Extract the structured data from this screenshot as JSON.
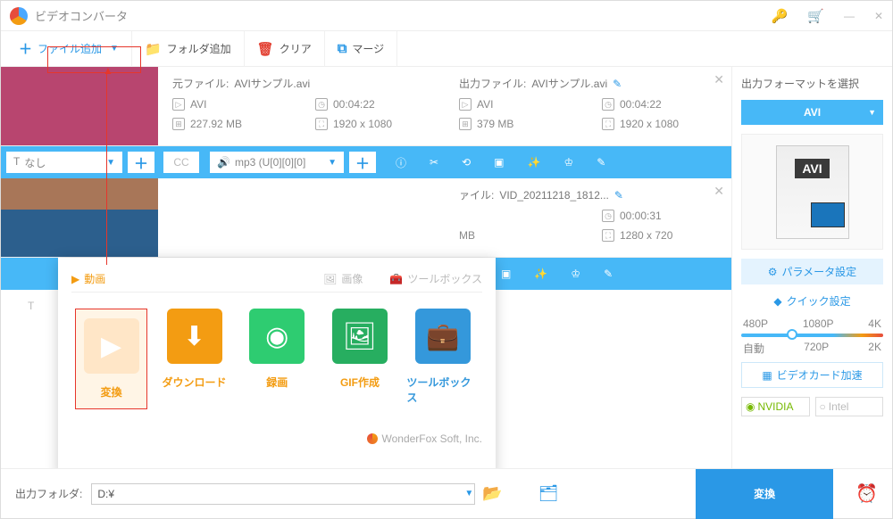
{
  "app": {
    "title": "ビデオコンバータ"
  },
  "toolbar": {
    "add_file": "ファイル追加",
    "add_folder": "フォルダ追加",
    "clear": "クリア",
    "merge": "マージ"
  },
  "files": [
    {
      "source": {
        "label": "元ファイル:",
        "name": "AVIサンプル.avi",
        "format": "AVI",
        "duration": "00:04:22",
        "size": "227.92 MB",
        "resolution": "1920 x 1080"
      },
      "output": {
        "label": "出力ファイル:",
        "name": "AVIサンプル.avi",
        "format": "AVI",
        "duration": "00:04:22",
        "size": "379 MB",
        "resolution": "1920 x 1080"
      },
      "subtitle": "なし",
      "audio": "mp3 (U[0][0][0]"
    },
    {
      "output": {
        "label": "ァイル:",
        "name": "VID_20211218_1812...",
        "duration": "00:00:31",
        "size": "MB",
        "resolution": "1280 x 720"
      }
    }
  ],
  "dropdown": {
    "tabs": {
      "video": "動画",
      "image": "画像",
      "toolbox": "ツールボックス"
    },
    "items": {
      "convert": "変換",
      "download": "ダウンロード",
      "record": "録画",
      "gif": "GIF作成",
      "toolbox": "ツールボックス"
    },
    "footer": "WonderFox Soft, Inc."
  },
  "sidebar": {
    "select_format": "出力フォーマットを選択",
    "format": "AVI",
    "avi_badge": "AVI",
    "parameter": "パラメータ設定",
    "quick": "クイック設定",
    "res": {
      "p480": "480P",
      "p1080": "1080P",
      "p4k": "4K",
      "auto": "自動",
      "p720": "720P",
      "p2k": "2K"
    },
    "gpu": "ビデオカード加速",
    "nvidia": "NVIDIA",
    "intel": "Intel"
  },
  "bottom": {
    "label": "出力フォルダ:",
    "path": "D:¥",
    "convert": "変換"
  }
}
